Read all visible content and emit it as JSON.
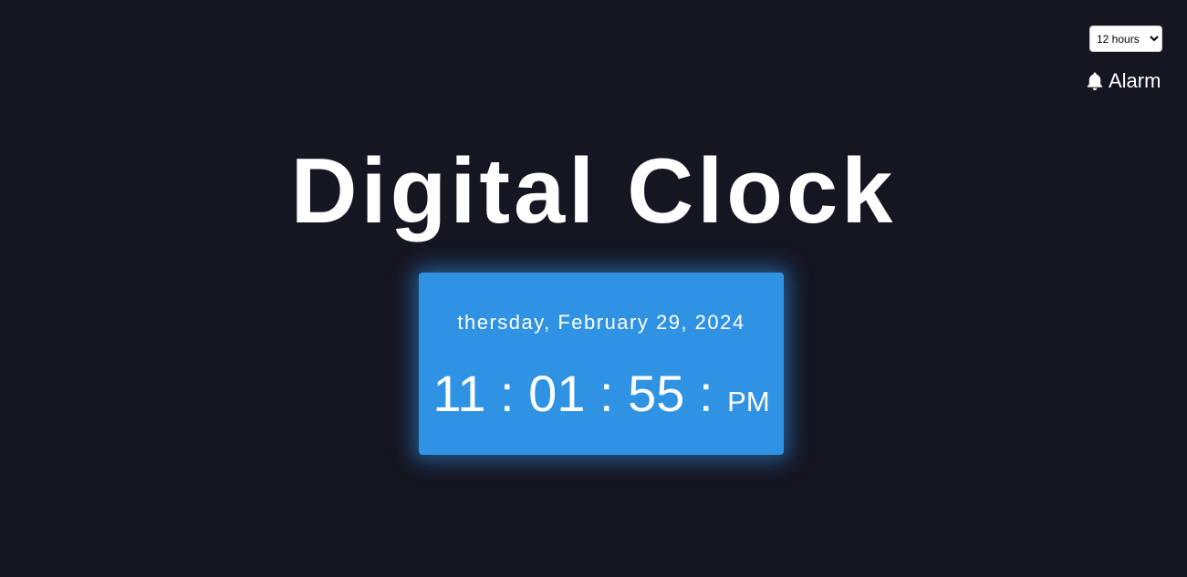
{
  "controls": {
    "format_options": [
      "12 hours"
    ],
    "format_selected": "12 hours",
    "alarm_label": "Alarm"
  },
  "title": "Digital Clock",
  "clock": {
    "date": "thersday, February 29, 2024",
    "hours": "11",
    "minutes": "01",
    "seconds": "55",
    "separator": ":",
    "ampm": "PM"
  },
  "icons": {
    "alarm": "bell-icon"
  },
  "colors": {
    "background": "#161623",
    "card": "#2f92e3",
    "text": "#ffffff"
  }
}
